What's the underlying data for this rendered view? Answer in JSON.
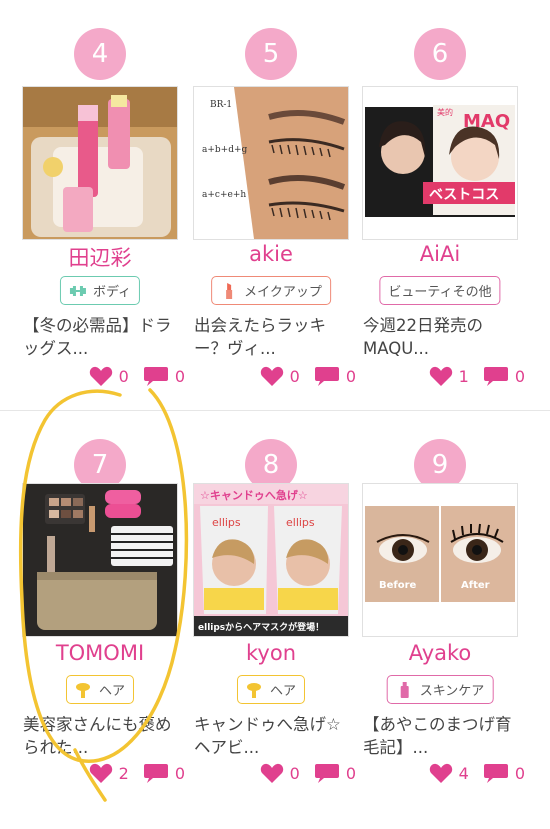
{
  "cards": [
    {
      "rank": "4",
      "author": "田辺彩",
      "tag": "ボディ",
      "tag_icon": "dumbbell-icon",
      "title": "【冬の必需品】ドラッグス...",
      "likes": "0",
      "comments": "0"
    },
    {
      "rank": "5",
      "author": "akie",
      "tag": "メイクアップ",
      "tag_icon": "lipstick-icon",
      "title": "出会えたらラッキー？ヴィ...",
      "likes": "0",
      "comments": "0",
      "thumb_labels": [
        "BR-1",
        "a+b+d+g",
        "a+c+e+h"
      ]
    },
    {
      "rank": "6",
      "author": "AiAi",
      "tag": "ビューティその他",
      "tag_icon": "",
      "title": "今週22日発売のMAQU...",
      "likes": "1",
      "comments": "0",
      "thumb_labels": [
        "美的",
        "MAQ",
        "ベストコス"
      ]
    },
    {
      "rank": "7",
      "author": "TOMOMI",
      "tag": "ヘア",
      "tag_icon": "hair-dryer-icon",
      "title": "美容家さんにも褒められた...",
      "likes": "2",
      "comments": "0"
    },
    {
      "rank": "8",
      "author": "kyon",
      "tag": "ヘア",
      "tag_icon": "hair-dryer-icon",
      "title": "キャンドゥへ急げ☆ヘアビ...",
      "likes": "0",
      "comments": "0",
      "thumb_labels": [
        "☆キャンドゥへ急げ☆",
        "ellips",
        "ellips",
        "ellipsからヘアマスクが登場！"
      ]
    },
    {
      "rank": "9",
      "author": "Ayako",
      "tag": "スキンケア",
      "tag_icon": "skincare-bottle-icon",
      "title": "【あやこのまつげ育毛記】...",
      "likes": "4",
      "comments": "0",
      "thumb_labels": [
        "Before",
        "After"
      ]
    }
  ],
  "colors": {
    "accent": "#e0408e",
    "rank_bg": "#f4a9c9",
    "tag_border": "#e06aa8",
    "highlight": "#f3c432"
  }
}
